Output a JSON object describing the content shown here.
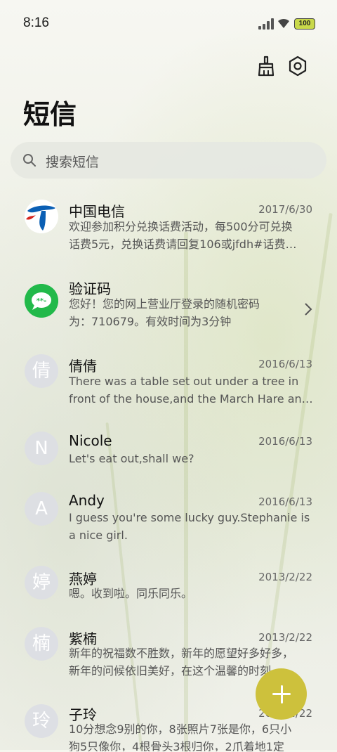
{
  "status_bar": {
    "time": "8:16",
    "battery": "100"
  },
  "header": {
    "title": "短信"
  },
  "search": {
    "placeholder": "搜索短信"
  },
  "conversations": [
    {
      "name": "中国电信",
      "date": "2017/6/30",
      "preview": "欢迎参加积分兑换话费活动，每500分可兑换\n话费5元，兑换话费请回复106或jfdh#话费…",
      "avatar_type": "china-telecom-logo"
    },
    {
      "name": "验证码",
      "date": "",
      "preview": "您好！您的网上营业厅登录的随机密码\n为：710679。有效时间为3分钟",
      "avatar_type": "message-bubble-icon"
    },
    {
      "name": "倩倩",
      "date": "2016/6/13",
      "preview": "There was a table set out under a tree in\nfront of the house,and the March Hare an…",
      "avatar": "倩"
    },
    {
      "name": "Nicole",
      "date": "2016/6/13",
      "preview": "Let's eat out,shall we?",
      "avatar": "N"
    },
    {
      "name": "Andy",
      "date": "2016/6/13",
      "preview": "I guess you're some lucky guy.Stephanie is\na nice girl.",
      "avatar": "A"
    },
    {
      "name": "燕婷",
      "date": "2013/2/22",
      "preview": "嗯。收到啦。同乐同乐。",
      "avatar": "婷"
    },
    {
      "name": "紫楠",
      "date": "2013/2/22",
      "preview": "新年的祝福数不胜数，新年的愿望好多好多，\n新年的问候依旧美好，在这个温馨的时刻…",
      "avatar": "楠"
    },
    {
      "name": "子玲",
      "date": "2013/2/22",
      "preview": "10分想念9别的你，8张照片7张是你，6只小\n狗5只像你，4根骨头3根归你，2爪着地1定",
      "avatar": "玲"
    }
  ],
  "colors": {
    "fab": "#cdc13c",
    "telecom_blue": "#0a5fb4",
    "green_bubble": "#22b94a"
  }
}
